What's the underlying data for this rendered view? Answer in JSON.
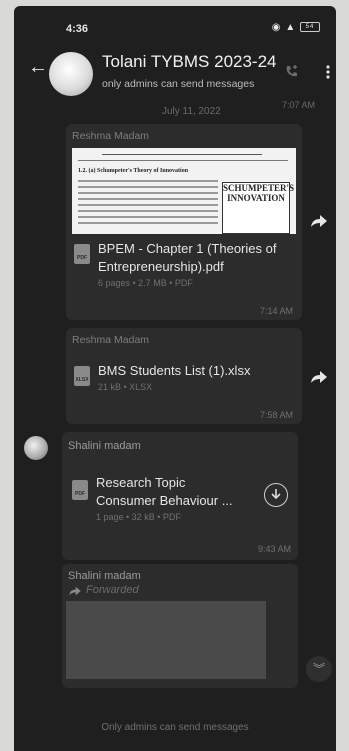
{
  "status": {
    "time": "4:36",
    "battery": "54"
  },
  "header": {
    "title": "Tolani TYBMS 2023-24",
    "subtitle": "only admins can send messages"
  },
  "chat": {
    "date": "July 11, 2022",
    "top_time": "7:07 AM",
    "messages": [
      {
        "sender": "Reshma Madam",
        "preview": {
          "heading": "1.2. (a) Schumpeter's Theory of Innovation",
          "book_title": "SCHUMPETER'S INNOVATION"
        },
        "file_name": "BPEM - Chapter 1 (Theories of Entrepreneurship).pdf",
        "file_type": "PDF",
        "meta": "6 pages • 2.7 MB • PDF",
        "time": "7:14 AM"
      },
      {
        "sender": "Reshma Madam",
        "file_name": "BMS Students List (1).xlsx",
        "file_type": "XLSX",
        "meta": "21 kB • XLSX",
        "time": "7:58 AM"
      },
      {
        "sender": "Shalini madam",
        "file_name": "Research Topic Consumer Behaviour ...",
        "file_type": "PDF",
        "meta": "1 page • 32 kB • PDF",
        "time": "9:43 AM"
      },
      {
        "sender": "Shalini madam",
        "forwarded_label": "Forwarded"
      }
    ]
  },
  "footer": {
    "text": "Only admins can send messages"
  },
  "icons": {
    "back": "arrow-left-icon",
    "call": "phone-plus-icon",
    "menu": "more-vertical-icon",
    "forward": "share-forward-icon",
    "download": "download-icon",
    "scroll": "chevrons-down-icon"
  },
  "colors": {
    "background": "#1f1f1f",
    "bubble": "#2c2c2c"
  }
}
